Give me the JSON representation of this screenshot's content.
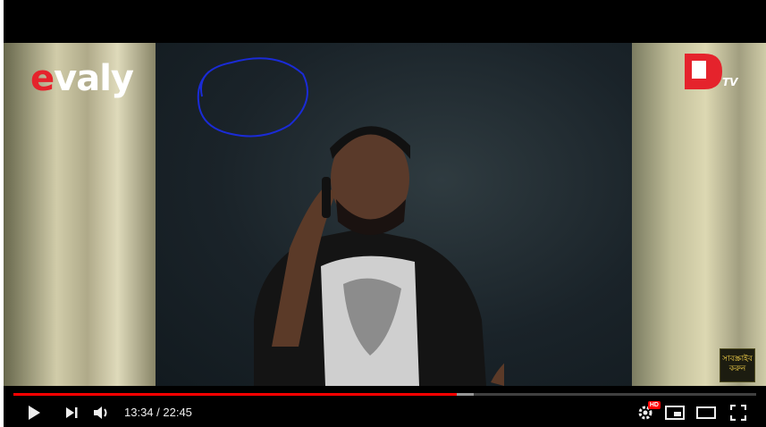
{
  "video": {
    "brand_logo_text": "evaly",
    "channel_logo_text": "D TV",
    "subscribe_badge_text": "সাবস্ক্রাইব করুন"
  },
  "player": {
    "current_time": "13:34",
    "duration": "22:45",
    "time_display": "13:34 / 22:45",
    "progress_fraction": 0.597,
    "buffered_fraction": 0.62,
    "quality_badge": "HD",
    "progress_color": "#ff0000"
  },
  "controls": {
    "play": "play-icon",
    "next": "next-icon",
    "volume": "volume-icon",
    "settings": "gear-icon",
    "miniplayer": "miniplayer-icon",
    "theater": "theater-mode-icon",
    "fullscreen": "fullscreen-icon"
  }
}
